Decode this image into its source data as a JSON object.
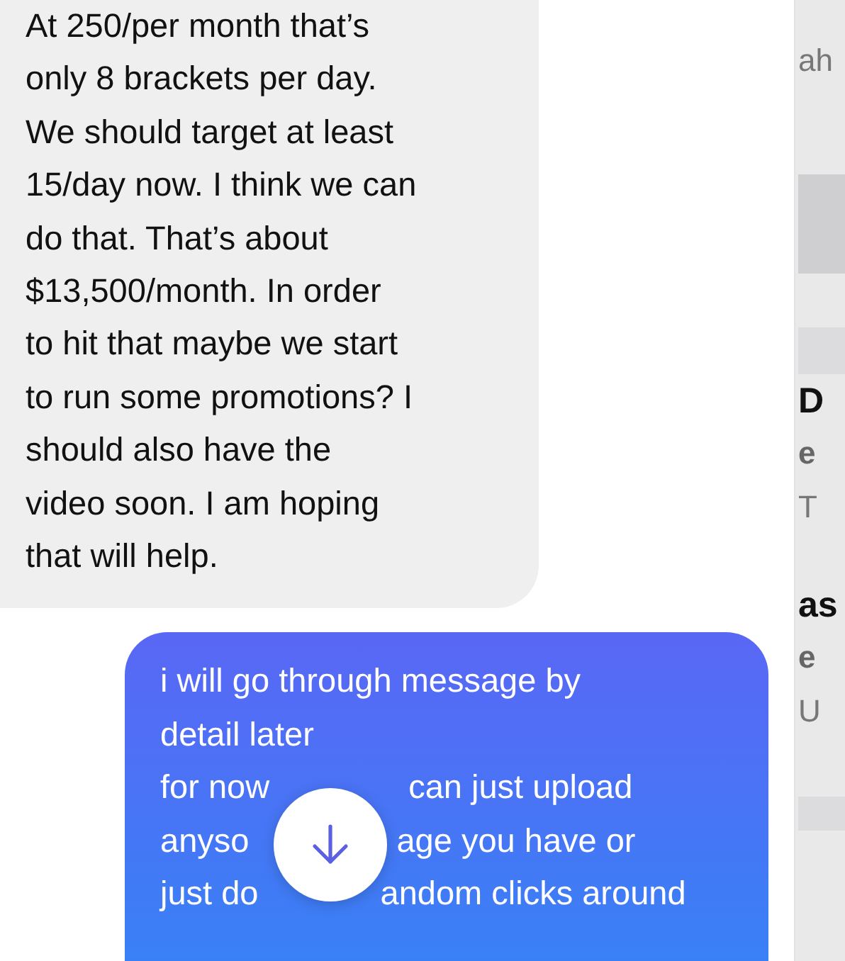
{
  "messages": [
    {
      "kind": "incoming",
      "lines": [
        [
          "At 250/per month that’s"
        ],
        [
          "only 8 brackets per day."
        ],
        [
          "We should target at least"
        ],
        [
          "15/day now. I think we can"
        ],
        [
          "do that.  That’s about"
        ],
        [
          "$13,500/month.  In order"
        ],
        [
          "to hit that maybe we start"
        ],
        [
          "to run some promotions? I"
        ],
        [
          "should also have the"
        ],
        [
          "video soon. I am hoping"
        ],
        [
          "that will help."
        ]
      ]
    },
    {
      "kind": "outgoing",
      "lines": [
        [
          "i will go through message by"
        ],
        [
          "detail later"
        ],
        [
          "for now",
          "can just upload"
        ],
        [
          "anyso",
          "age you have or"
        ],
        [
          "just do",
          "andom clicks around"
        ]
      ]
    }
  ],
  "side_panel": {
    "header_text": "ah",
    "items": [
      {
        "title": "D",
        "subtitle": "e",
        "preview": "T"
      },
      {
        "title": "as",
        "subtitle": "e",
        "preview": "U"
      }
    ]
  }
}
